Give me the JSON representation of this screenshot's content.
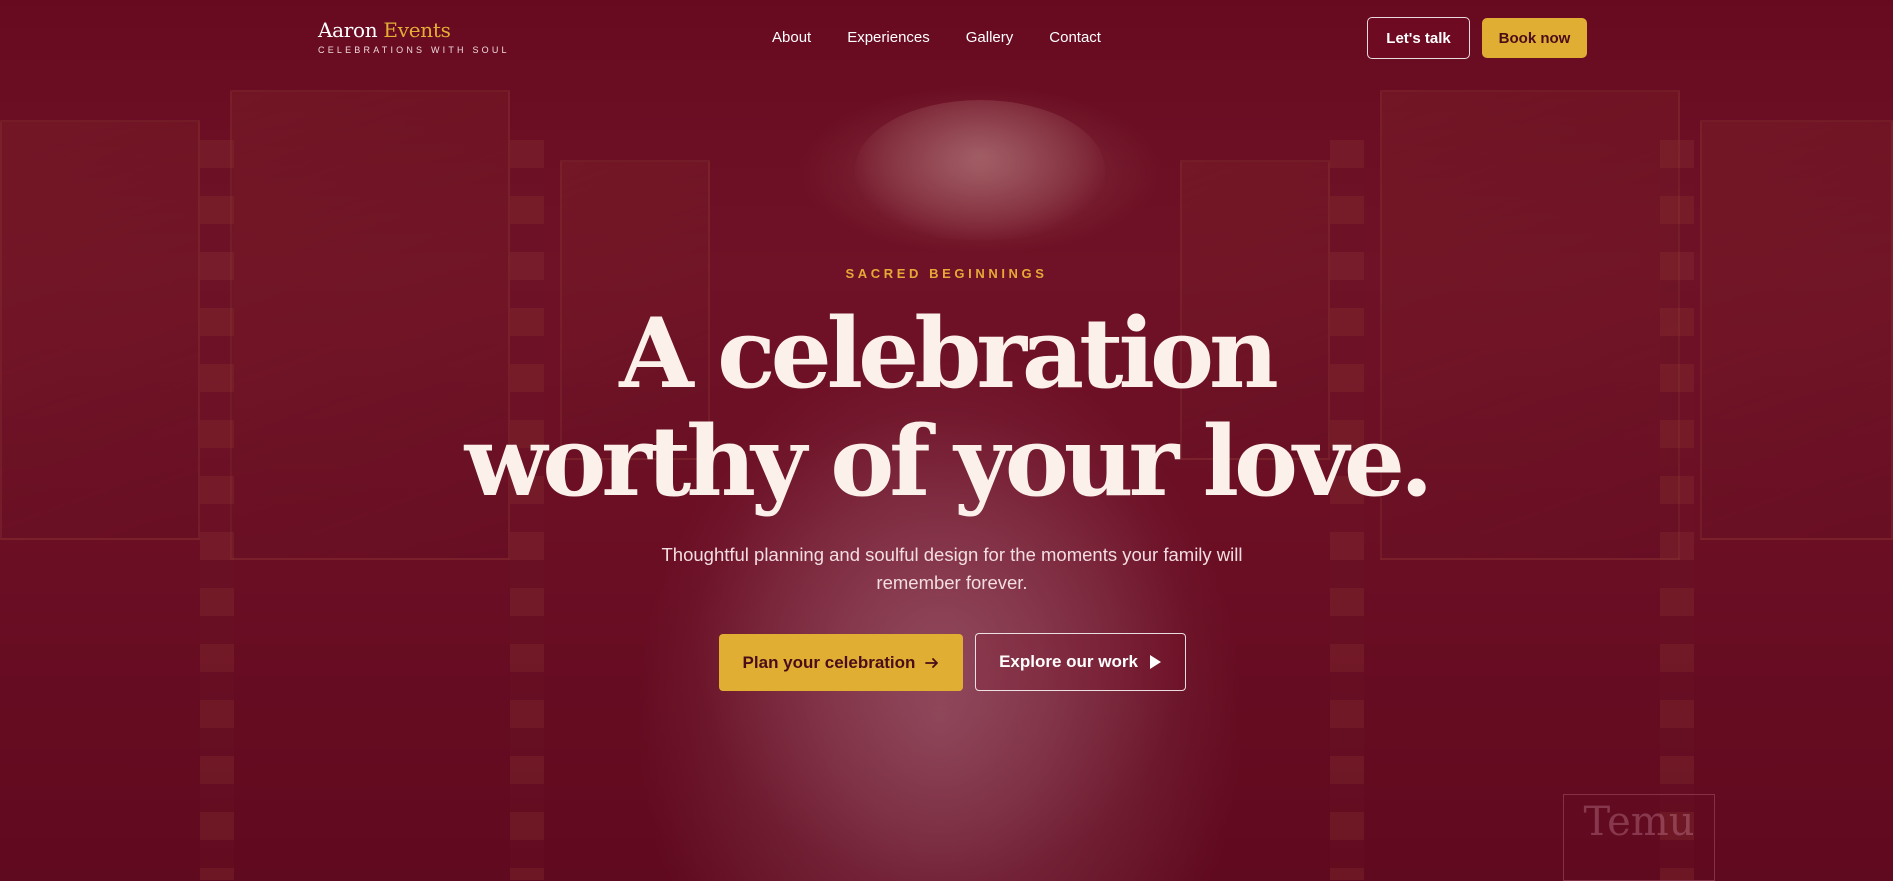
{
  "brand": {
    "name_primary": "Aaron",
    "name_accent": "Events",
    "tagline": "CELEBRATIONS WITH SOUL"
  },
  "nav": {
    "items": [
      {
        "label": "About"
      },
      {
        "label": "Experiences"
      },
      {
        "label": "Gallery"
      },
      {
        "label": "Contact"
      }
    ]
  },
  "header_actions": {
    "talk_label": "Let's talk",
    "book_label": "Book now"
  },
  "hero": {
    "eyebrow": "SACRED BEGINNINGS",
    "headline_line1": "A celebration",
    "headline_line2": "worthy of your love.",
    "subtitle": "Thoughtful planning and soulful design for the moments your family will remember forever.",
    "primary_cta": "Plan your celebration",
    "primary_cta_icon": "arrow-right-icon",
    "secondary_cta": "Explore our work",
    "secondary_cta_icon": "play-icon",
    "background_image_watermark": "Temu Photography"
  },
  "colors": {
    "accent_gold": "#e0ae33",
    "overlay_maroon": "#6b0c22",
    "headline_cream": "#fbf1ea"
  }
}
